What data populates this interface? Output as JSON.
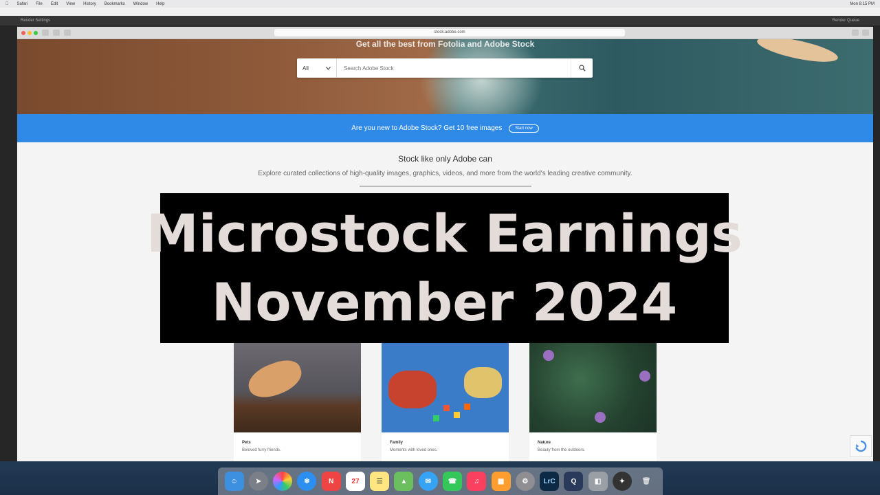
{
  "menubar": {
    "items": [
      "Safari",
      "File",
      "Edit",
      "View",
      "History",
      "Bookmarks",
      "Window",
      "Help"
    ],
    "clock": "Mon 8:15 PM"
  },
  "editor": {
    "toolbar_left": "Render Settings",
    "toolbar_right": "Render Queue"
  },
  "browser": {
    "url": "stock.adobe.com"
  },
  "hero": {
    "tagline": "Get all the best from Fotolia and Adobe Stock",
    "search_scope": "All",
    "search_placeholder": "Search Adobe Stock"
  },
  "banner": {
    "text": "Are you new to Adobe Stock? Get 10 free images",
    "button": "Start now"
  },
  "section": {
    "title": "Stock like only Adobe can",
    "subtitle": "Explore curated collections of high-quality images, graphics, videos, and more from the world's leading creative community."
  },
  "cards": [
    {
      "title": "Pets",
      "desc": "Beloved furry friends."
    },
    {
      "title": "Family",
      "desc": "Moments with loved ones."
    },
    {
      "title": "Nature",
      "desc": "Beauty from the outdoors."
    }
  ],
  "overlay": {
    "line1": "Microstock Earnings",
    "line2": "November 2024"
  },
  "dock": {
    "lightroom_label": "LrC"
  },
  "colors": {
    "banner_blue": "#2e8ae6",
    "overlay_text": "#e3dcd8"
  }
}
